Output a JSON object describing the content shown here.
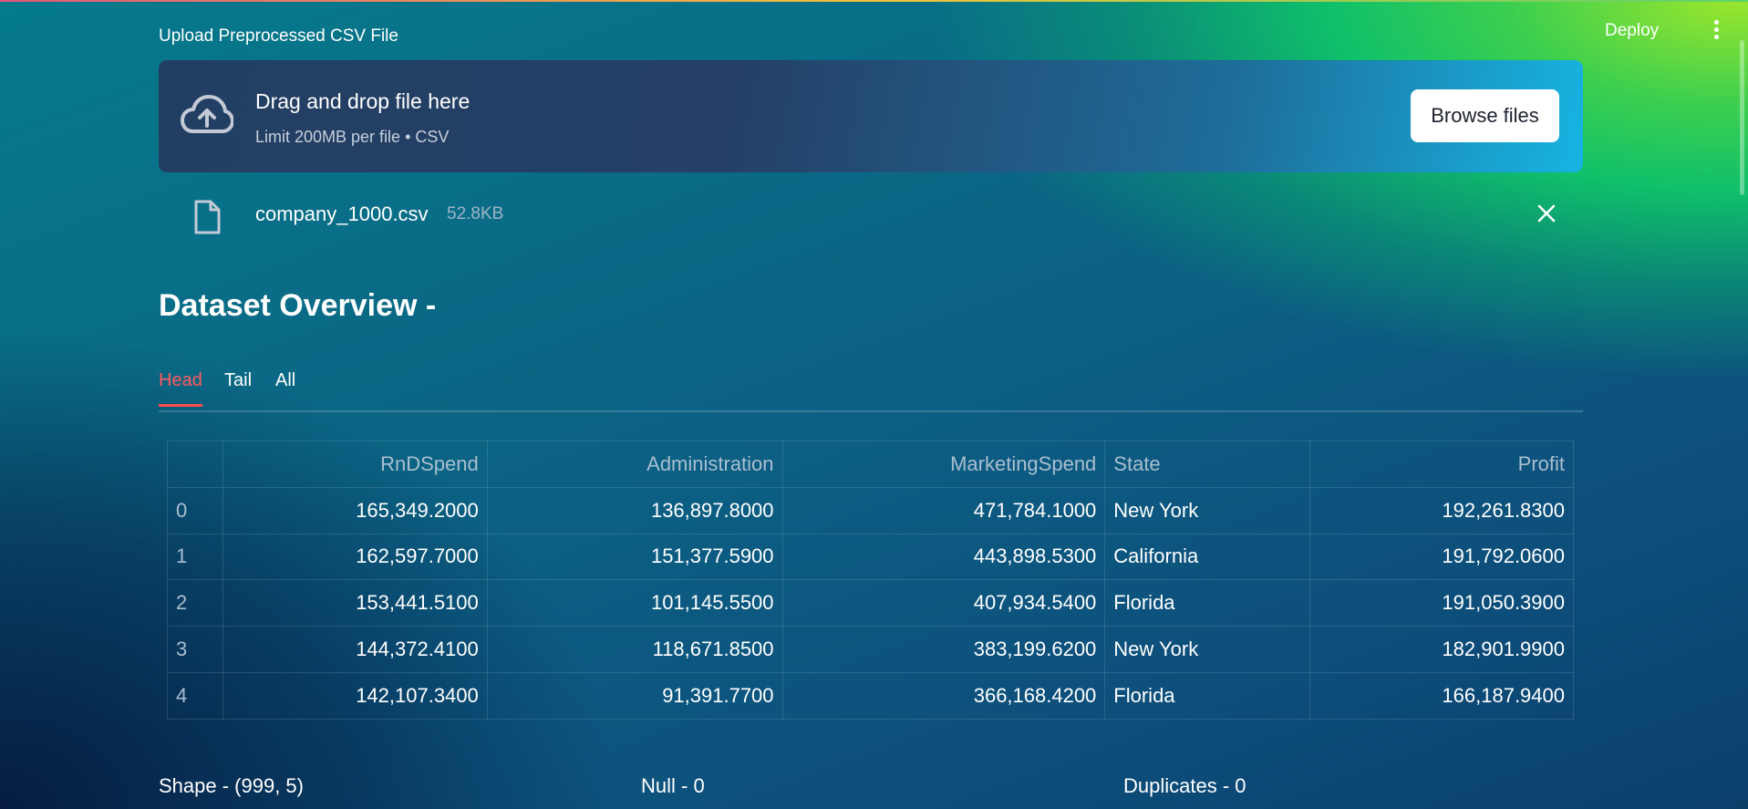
{
  "header": {
    "deploy_label": "Deploy",
    "menu_icon": "kebab-menu-icon"
  },
  "uploader": {
    "label": "Upload Preprocessed CSV File",
    "drop_title": "Drag and drop file here",
    "drop_subtitle": "Limit 200MB per file • CSV",
    "browse_label": "Browse files",
    "file": {
      "name": "company_1000.csv",
      "size": "52.8KB"
    }
  },
  "overview": {
    "title": "Dataset Overview -",
    "tabs": [
      {
        "label": "Head"
      },
      {
        "label": "Tail"
      },
      {
        "label": "All"
      }
    ],
    "active_tab": "Head"
  },
  "table": {
    "columns": [
      "",
      "RnDSpend",
      "Administration",
      "MarketingSpend",
      "State",
      "Profit"
    ],
    "rows": [
      [
        "0",
        "165,349.2000",
        "136,897.8000",
        "471,784.1000",
        "New York",
        "192,261.8300"
      ],
      [
        "1",
        "162,597.7000",
        "151,377.5900",
        "443,898.5300",
        "California",
        "191,792.0600"
      ],
      [
        "2",
        "153,441.5100",
        "101,145.5500",
        "407,934.5400",
        "Florida",
        "191,050.3900"
      ],
      [
        "3",
        "144,372.4100",
        "118,671.8500",
        "383,199.6200",
        "New York",
        "182,901.9900"
      ],
      [
        "4",
        "142,107.3400",
        "91,391.7700",
        "366,168.4200",
        "Florida",
        "166,187.9400"
      ]
    ]
  },
  "stats": {
    "shape": "Shape - (999, 5)",
    "nulls": "Null - 0",
    "duplicates": "Duplicates - 0"
  },
  "colors": {
    "accent": "#ff4b4b",
    "button_bg": "#ffffff"
  }
}
